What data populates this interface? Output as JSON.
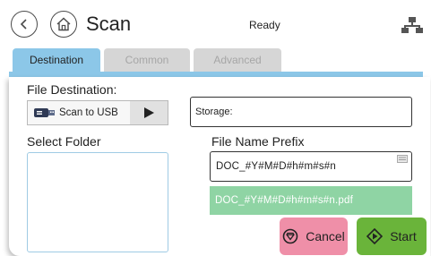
{
  "header": {
    "title": "Scan",
    "status": "Ready",
    "back_icon": "chevron-left-icon",
    "home_icon": "home-icon",
    "network_icon": "network-icon"
  },
  "tabs": [
    {
      "label": "Destination",
      "active": true
    },
    {
      "label": "Common",
      "active": false
    },
    {
      "label": "Advanced",
      "active": false
    }
  ],
  "form": {
    "file_destination_label": "File Destination:",
    "destination_value": "Scan to USB",
    "storage_value": "Storage:",
    "select_folder_label": "Select Folder",
    "file_name_prefix_label": "File Name Prefix",
    "prefix_value": "DOC_#Y#M#D#h#m#s#n",
    "prefix_preview": "DOC_#Y#M#D#h#m#s#n.pdf"
  },
  "actions": {
    "cancel_label": "Cancel",
    "start_label": "Start"
  },
  "colors": {
    "tab_active": "#8cc7e8",
    "tab_inactive": "#d6d6d6",
    "cancel": "#ef8fa8",
    "start": "#6ab43a",
    "preview": "#8fd4a4"
  }
}
